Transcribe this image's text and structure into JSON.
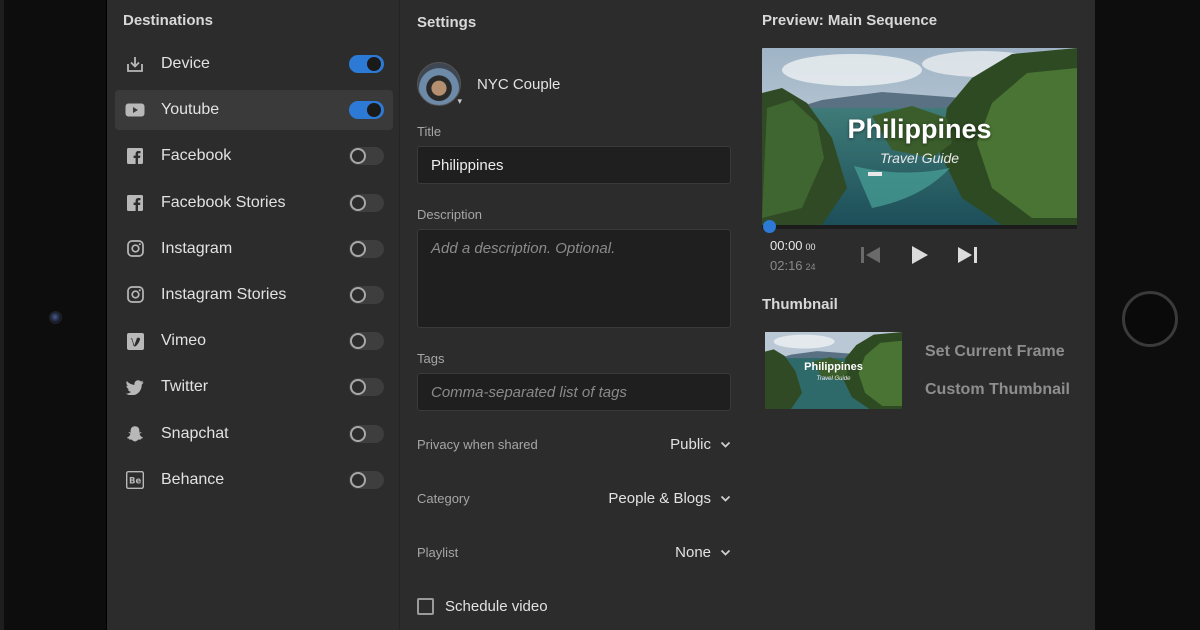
{
  "destinations": {
    "title": "Destinations",
    "items": [
      {
        "label": "Device",
        "icon": "download-icon",
        "enabled": true,
        "active": false
      },
      {
        "label": "Youtube",
        "icon": "youtube-icon",
        "enabled": true,
        "active": true
      },
      {
        "label": "Facebook",
        "icon": "facebook-icon",
        "enabled": false,
        "active": false
      },
      {
        "label": "Facebook Stories",
        "icon": "facebook-icon",
        "enabled": false,
        "active": false
      },
      {
        "label": "Instagram",
        "icon": "instagram-icon",
        "enabled": false,
        "active": false
      },
      {
        "label": "Instagram Stories",
        "icon": "instagram-icon",
        "enabled": false,
        "active": false
      },
      {
        "label": "Vimeo",
        "icon": "vimeo-icon",
        "enabled": false,
        "active": false
      },
      {
        "label": "Twitter",
        "icon": "twitter-icon",
        "enabled": false,
        "active": false
      },
      {
        "label": "Snapchat",
        "icon": "snapchat-icon",
        "enabled": false,
        "active": false
      },
      {
        "label": "Behance",
        "icon": "behance-icon",
        "enabled": false,
        "active": false
      }
    ]
  },
  "settings": {
    "title": "Settings",
    "account_name": "NYC Couple",
    "title_label": "Title",
    "title_value": "Philippines",
    "description_label": "Description",
    "description_placeholder": "Add a description. Optional.",
    "tags_label": "Tags",
    "tags_placeholder": "Comma-separated list of tags",
    "privacy": {
      "label": "Privacy when shared",
      "value": "Public"
    },
    "category": {
      "label": "Category",
      "value": "People & Blogs"
    },
    "playlist": {
      "label": "Playlist",
      "value": "None"
    },
    "schedule_label": "Schedule video",
    "schedule_checked": false
  },
  "preview": {
    "title": "Preview: Main Sequence",
    "video_title": "Philippines",
    "video_subtitle": "Travel Guide",
    "time_current": "00:00",
    "time_current_frames": "00",
    "time_total": "02:16",
    "time_total_frames": "24",
    "playback_progress": 0
  },
  "thumbnail": {
    "title": "Thumbnail",
    "image_title": "Philippines",
    "image_subtitle": "Travel Guide",
    "set_current_frame": "Set Current Frame",
    "custom_thumbnail": "Custom Thumbnail"
  },
  "colors": {
    "accent": "#2d7ad6",
    "background": "#2c2c2c",
    "field": "#1f1f1f"
  }
}
